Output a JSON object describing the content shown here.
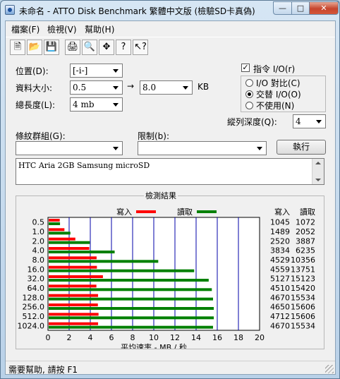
{
  "window": {
    "title": "未命名 - ATTO Disk Benchmark  繁體中文版 (檢驗SD卡真偽)"
  },
  "menu": [
    "檔案(F)",
    "檢視(V)",
    "幫助(H)"
  ],
  "toolbar_icons": [
    "new-document-icon",
    "open-folder-icon",
    "save-disk-icon",
    "print-icon",
    "print-preview-icon",
    "move-icon",
    "help-icon",
    "context-help-icon"
  ],
  "settings": {
    "drive_label": "位置(D):",
    "drive_value": "[-i-]",
    "transfer_size_label": "資料大小:",
    "transfer_from": "0.5",
    "arrow": "→",
    "transfer_to": "8.0",
    "transfer_unit": "KB",
    "total_length_label": "總長度(L):",
    "total_length_value": "4 mb",
    "direct_io_label": "指令 I/O(r)",
    "direct_io_checked": true,
    "io_compare_label": "I/O 對比(C)",
    "overlapped_io_label": "交替 I/O(O)",
    "neither_label": "不使用(N)",
    "queue_depth_label": "縱列深度(Q):",
    "queue_depth_value": "4",
    "controlled_by_label": "條紋群組(G):",
    "controlled_by_value": "",
    "restrict_label": "限制(b):",
    "restrict_value": "",
    "start_button": "執行"
  },
  "description": "HTC Aria 2GB Samsung microSD",
  "results": {
    "group_title": "檢測結果",
    "legend_write": "寫入",
    "legend_read": "讀取",
    "col_write": "寫入",
    "col_read": "讀取",
    "xlabel": "平均速率 - MB / 秒"
  },
  "chart_data": {
    "type": "bar",
    "orientation": "horizontal",
    "categories": [
      "0.5",
      "1.0",
      "2.0",
      "4.0",
      "8.0",
      "16.0",
      "32.0",
      "64.0",
      "128.0",
      "256.0",
      "512.0",
      "1024.0"
    ],
    "series": [
      {
        "name": "寫入",
        "color": "#ff0000",
        "values": [
          1045,
          1489,
          2520,
          3834,
          4529,
          4559,
          5127,
          4510,
          4670,
          4650,
          4712,
          4670
        ]
      },
      {
        "name": "讀取",
        "color": "#008000",
        "values": [
          1072,
          2052,
          3887,
          6235,
          10356,
          13751,
          15123,
          15420,
          15534,
          15606,
          15606,
          15534
        ]
      }
    ],
    "x_ticks": [
      "0",
      "2",
      "4",
      "6",
      "8",
      "10",
      "12",
      "14",
      "16",
      "18",
      "20"
    ],
    "xlim": [
      0,
      20
    ],
    "value_unit_divisor": 1000,
    "xlabel": "平均速率 - MB / 秒"
  },
  "colors": {
    "write": "#ff0000",
    "read": "#008000",
    "grid": "#0000aa"
  },
  "status": "需要幫助, 請按 F1"
}
